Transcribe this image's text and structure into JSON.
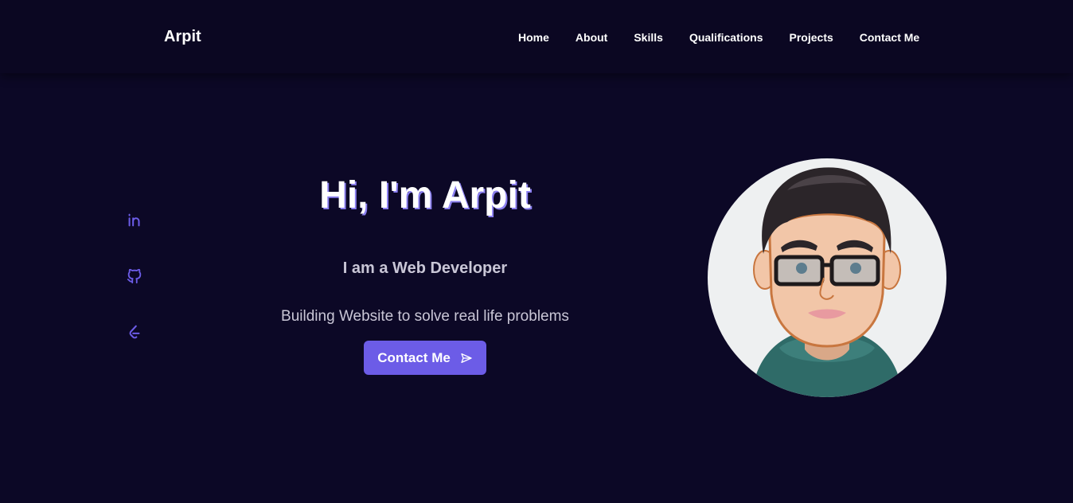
{
  "header": {
    "logo": "Arpit",
    "nav": [
      "Home",
      "About",
      "Skills",
      "Qualifications",
      "Projects",
      "Contact Me"
    ]
  },
  "social": [
    {
      "icon": "linkedin-icon"
    },
    {
      "icon": "github-icon"
    },
    {
      "icon": "leetcode-icon"
    }
  ],
  "hero": {
    "title": "Hi, I'm Arpit",
    "subtitle": "I am a Web Developer",
    "description": "Building Website to solve real life problems",
    "cta_label": "Contact Me",
    "cta_icon": "send-icon"
  },
  "colors": {
    "background": "#0c0826",
    "header": "#0b0722",
    "accent": "#6c5ce7",
    "text": "#ffffff",
    "muted": "#c9c6d6"
  }
}
